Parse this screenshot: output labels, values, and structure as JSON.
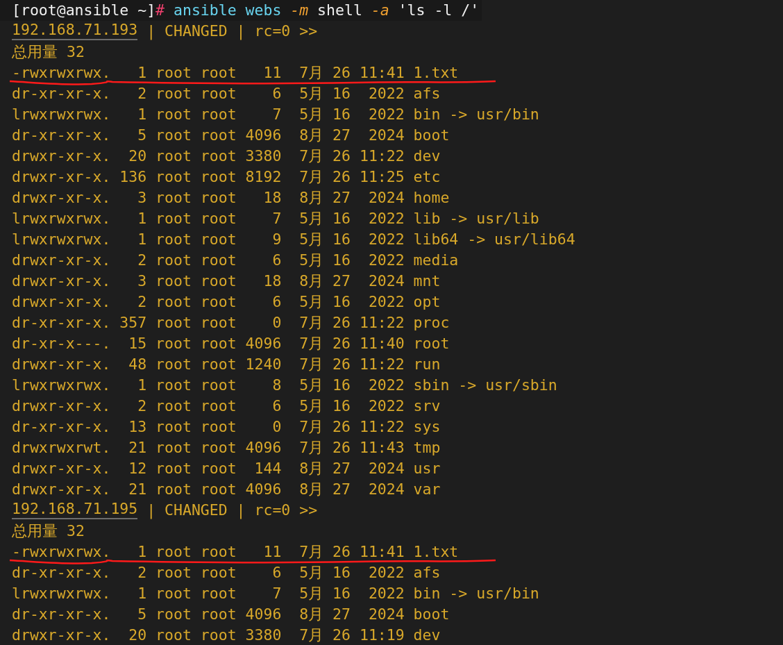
{
  "command": [
    {
      "kind": "prompt",
      "text": "[root@ansible ~]"
    },
    {
      "kind": "hash",
      "text": "#"
    },
    {
      "kind": "command",
      "text": " ansible webs "
    },
    {
      "kind": "flag",
      "text": "-m"
    },
    {
      "kind": "arg",
      "text": " shell "
    },
    {
      "kind": "flag",
      "text": "-a"
    },
    {
      "kind": "arg",
      "text": " 'ls -l /'"
    }
  ],
  "output": [
    {
      "kind": "status",
      "host": "192.168.71.193",
      "text": " | CHANGED | rc=0 >>"
    },
    {
      "kind": "text",
      "text": "总用量 32"
    },
    {
      "kind": "text",
      "text": "-rwxrwxrwx.   1 root root   11  7月 26 11:41 1.txt",
      "underlined": true
    },
    {
      "kind": "text",
      "text": "dr-xr-xr-x.   2 root root    6  5月 16  2022 afs"
    },
    {
      "kind": "text",
      "text": "lrwxrwxrwx.   1 root root    7  5月 16  2022 bin -> usr/bin"
    },
    {
      "kind": "text",
      "text": "dr-xr-xr-x.   5 root root 4096  8月 27  2024 boot"
    },
    {
      "kind": "text",
      "text": "drwxr-xr-x.  20 root root 3380  7月 26 11:22 dev"
    },
    {
      "kind": "text",
      "text": "drwxr-xr-x. 136 root root 8192  7月 26 11:25 etc"
    },
    {
      "kind": "text",
      "text": "drwxr-xr-x.   3 root root   18  8月 27  2024 home"
    },
    {
      "kind": "text",
      "text": "lrwxrwxrwx.   1 root root    7  5月 16  2022 lib -> usr/lib"
    },
    {
      "kind": "text",
      "text": "lrwxrwxrwx.   1 root root    9  5月 16  2022 lib64 -> usr/lib64"
    },
    {
      "kind": "text",
      "text": "drwxr-xr-x.   2 root root    6  5月 16  2022 media"
    },
    {
      "kind": "text",
      "text": "drwxr-xr-x.   3 root root   18  8月 27  2024 mnt"
    },
    {
      "kind": "text",
      "text": "drwxr-xr-x.   2 root root    6  5月 16  2022 opt"
    },
    {
      "kind": "text",
      "text": "dr-xr-xr-x. 357 root root    0  7月 26 11:22 proc"
    },
    {
      "kind": "text",
      "text": "dr-xr-x---.  15 root root 4096  7月 26 11:40 root"
    },
    {
      "kind": "text",
      "text": "drwxr-xr-x.  48 root root 1240  7月 26 11:22 run"
    },
    {
      "kind": "text",
      "text": "lrwxrwxrwx.   1 root root    8  5月 16  2022 sbin -> usr/sbin"
    },
    {
      "kind": "text",
      "text": "drwxr-xr-x.   2 root root    6  5月 16  2022 srv"
    },
    {
      "kind": "text",
      "text": "dr-xr-xr-x.  13 root root    0  7月 26 11:22 sys"
    },
    {
      "kind": "text",
      "text": "drwxrwxrwt.  21 root root 4096  7月 26 11:43 tmp"
    },
    {
      "kind": "text",
      "text": "drwxr-xr-x.  12 root root  144  8月 27  2024 usr"
    },
    {
      "kind": "text",
      "text": "drwxr-xr-x.  21 root root 4096  8月 27  2024 var"
    },
    {
      "kind": "status",
      "host": "192.168.71.195",
      "text": " | CHANGED | rc=0 >>"
    },
    {
      "kind": "text",
      "text": "总用量 32"
    },
    {
      "kind": "text",
      "text": "-rwxrwxrwx.   1 root root   11  7月 26 11:41 1.txt",
      "underlined": true
    },
    {
      "kind": "text",
      "text": "dr-xr-xr-x.   2 root root    6  5月 16  2022 afs"
    },
    {
      "kind": "text",
      "text": "lrwxrwxrwx.   1 root root    7  5月 16  2022 bin -> usr/bin"
    },
    {
      "kind": "text",
      "text": "dr-xr-xr-x.   5 root root 4096  8月 27  2024 boot"
    },
    {
      "kind": "text",
      "text": "drwxr-xr-x.  20 root root 3380  7月 26 11:19 dev"
    }
  ]
}
